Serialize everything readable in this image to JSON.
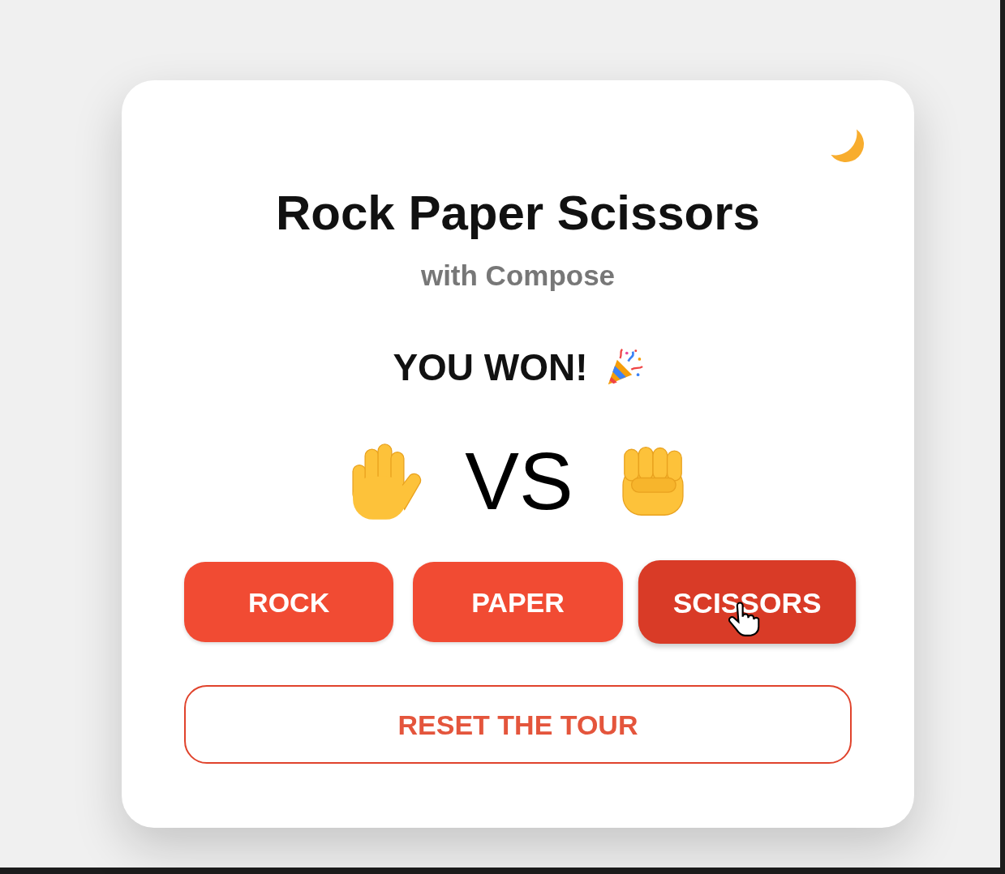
{
  "theme_toggle": {
    "kind": "moon"
  },
  "title": "Rock Paper Scissors",
  "subtitle": "with Compose",
  "result": {
    "text": "YOU WON!",
    "kind": "win"
  },
  "matchup": {
    "player": {
      "kind": "paper"
    },
    "label": "VS",
    "computer": {
      "kind": "rock"
    }
  },
  "choices": [
    {
      "label": "ROCK",
      "hovered": false
    },
    {
      "label": "PAPER",
      "hovered": false
    },
    {
      "label": "SCISSORS",
      "hovered": true
    }
  ],
  "reset_button": {
    "label": "RESET THE TOUR"
  }
}
